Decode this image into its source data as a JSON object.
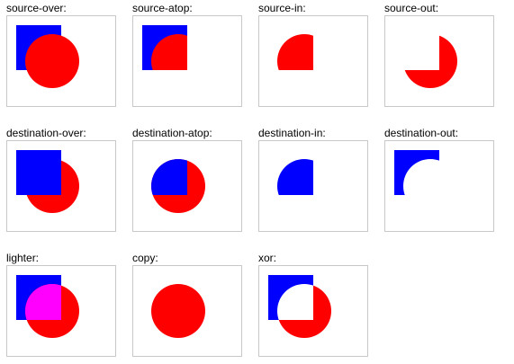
{
  "colors": {
    "source": "#ff0000",
    "destination": "#0000ff",
    "lighter_overlap": "#ff00ff",
    "background": "#ffffff",
    "border": "#c8c8c8"
  },
  "shapes": {
    "destination": "blue-square",
    "source": "red-circle"
  },
  "modes": [
    {
      "id": "source-over",
      "label": "source-over:"
    },
    {
      "id": "source-atop",
      "label": "source-atop:"
    },
    {
      "id": "source-in",
      "label": "source-in:"
    },
    {
      "id": "source-out",
      "label": "source-out:"
    },
    {
      "id": "destination-over",
      "label": "destination-over:"
    },
    {
      "id": "destination-atop",
      "label": "destination-atop:"
    },
    {
      "id": "destination-in",
      "label": "destination-in:"
    },
    {
      "id": "destination-out",
      "label": "destination-out:"
    },
    {
      "id": "lighter",
      "label": "lighter:"
    },
    {
      "id": "copy",
      "label": "copy:"
    },
    {
      "id": "xor",
      "label": "xor:"
    }
  ]
}
